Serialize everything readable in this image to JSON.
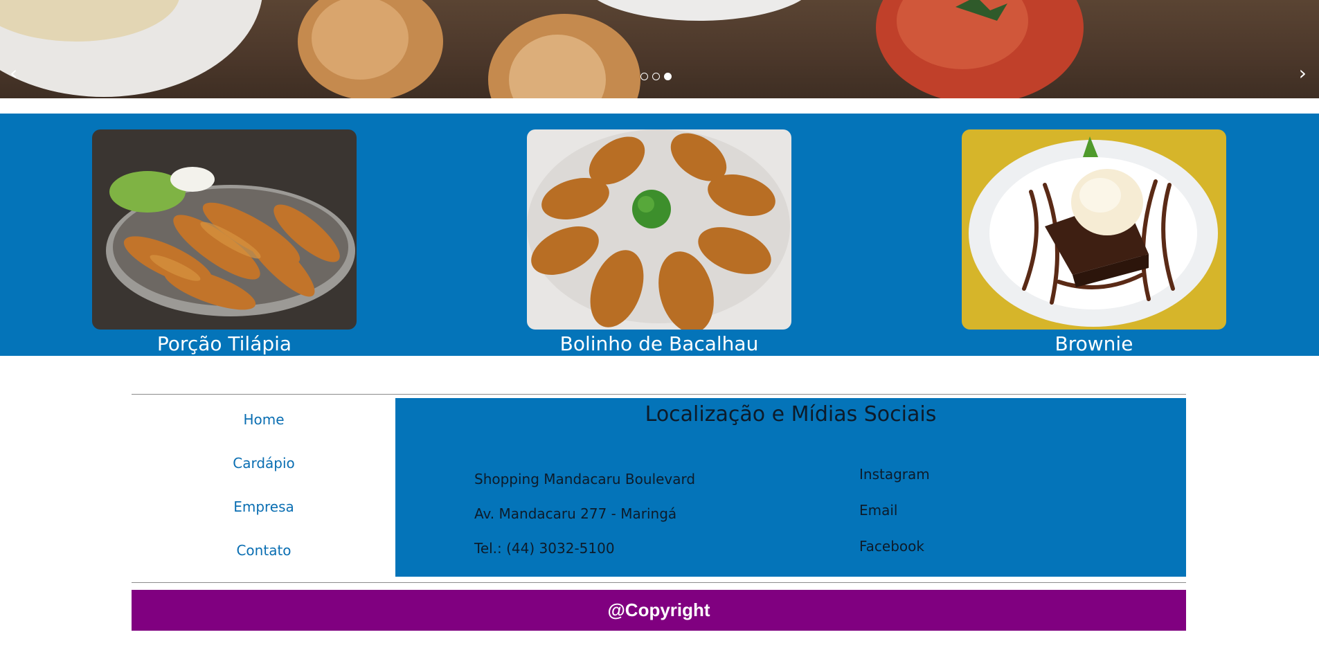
{
  "carousel": {
    "prev_label": "‹",
    "next_label": "›",
    "slide_count": 3,
    "active_slide": 3
  },
  "featured": [
    {
      "name": "Porção Tilápia"
    },
    {
      "name": "Bolinho de Bacalhau"
    },
    {
      "name": "Brownie"
    }
  ],
  "nav": {
    "items": [
      "Home",
      "Cardápio",
      "Empresa",
      "Contato"
    ]
  },
  "location": {
    "title": "Localização e Mídias Sociais",
    "address": [
      "Shopping Mandacaru Boulevard",
      "Av. Mandacaru 277 - Maringá",
      "Tel.: (44) 3032-5100"
    ],
    "social": [
      "Instagram",
      "Email",
      "Facebook"
    ]
  },
  "footer": {
    "copyright": "@Copyright"
  },
  "colors": {
    "accent_blue": "#0474b9",
    "footer_purple": "#800080",
    "link_blue": "#0a6eb2"
  }
}
